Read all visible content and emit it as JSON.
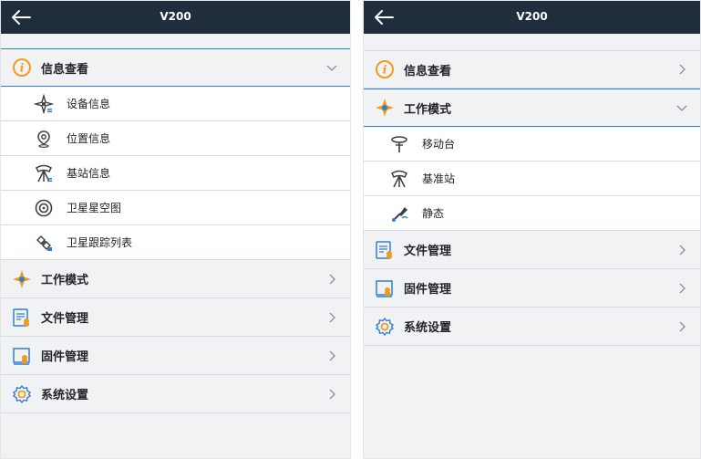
{
  "left": {
    "title": "V200",
    "expanded_section": "信息查看",
    "sections": [
      {
        "label": "信息查看",
        "icon": "info-icon",
        "expanded": true,
        "subitems": [
          {
            "label": "设备信息",
            "icon": "device-compass-icon"
          },
          {
            "label": "位置信息",
            "icon": "location-pin-icon"
          },
          {
            "label": "基站信息",
            "icon": "base-station-icon"
          },
          {
            "label": "卫星星空图",
            "icon": "sky-plot-icon"
          },
          {
            "label": "卫星跟踪列表",
            "icon": "satellite-track-icon"
          }
        ]
      },
      {
        "label": "工作模式",
        "icon": "work-mode-icon"
      },
      {
        "label": "文件管理",
        "icon": "file-management-icon"
      },
      {
        "label": "固件管理",
        "icon": "firmware-icon"
      },
      {
        "label": "系统设置",
        "icon": "settings-gear-icon"
      }
    ]
  },
  "right": {
    "title": "V200",
    "sections": [
      {
        "label": "信息查看",
        "icon": "info-icon"
      },
      {
        "label": "工作模式",
        "icon": "work-mode-icon",
        "expanded": true,
        "subitems": [
          {
            "label": "移动台",
            "icon": "rover-icon"
          },
          {
            "label": "基准站",
            "icon": "base-station-icon"
          },
          {
            "label": "静态",
            "icon": "static-survey-icon"
          }
        ]
      },
      {
        "label": "文件管理",
        "icon": "file-management-icon"
      },
      {
        "label": "固件管理",
        "icon": "firmware-icon"
      },
      {
        "label": "系统设置",
        "icon": "settings-gear-icon"
      }
    ]
  },
  "colors": {
    "titlebar": "#1f2d3d",
    "accent_orange": "#f29a1f",
    "accent_blue": "#2e7fd3",
    "row_divider": "#d7dbe1"
  }
}
